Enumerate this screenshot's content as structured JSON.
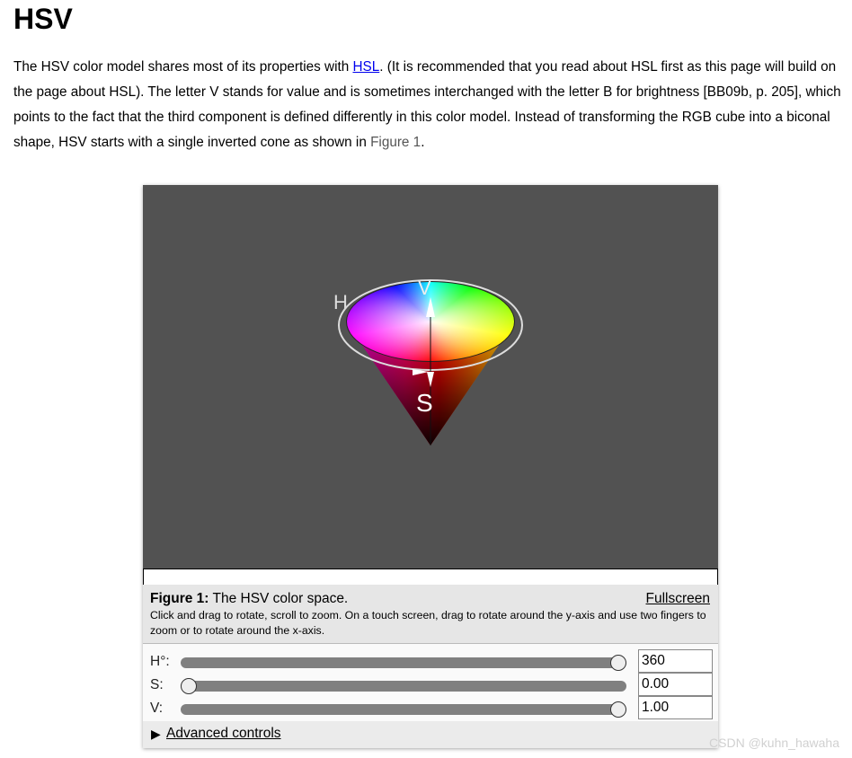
{
  "page": {
    "title": "HSV",
    "intro_before_link": "The HSV color model shares most of its properties with ",
    "hsl_link": "HSL",
    "intro_middle": ". (It is recommended that you read about HSL first as this page will build on the page about HSL). The letter V stands for value and is sometimes interchanged with the letter B for brightness [BB09b, p. 205], which points to the fact that the third component is defined differently in this color model. Instead of transforming the RGB cube into a biconal shape, HSV starts with a single inverted cone as shown in ",
    "figure_link": "Figure 1",
    "intro_end": "."
  },
  "figure": {
    "axis_labels": {
      "h": "H",
      "v": "V",
      "s": "S"
    },
    "caption_label": "Figure 1:",
    "caption_text": " The HSV color space.",
    "fullscreen": "Fullscreen",
    "description": "Click and drag to rotate, scroll to zoom. On a touch screen, drag to rotate around the y-axis and use two fingers to zoom or to rotate around the x-axis.",
    "sliders": [
      {
        "label": "H°:",
        "value": "360",
        "fraction": 1.0
      },
      {
        "label": "S:",
        "value": "0.00",
        "fraction": 0.0
      },
      {
        "label": "V:",
        "value": "1.00",
        "fraction": 1.0
      }
    ],
    "advanced_controls": "Advanced controls",
    "canvas_background": "#525252"
  },
  "watermark": "CSDN @kuhn_hawaha"
}
